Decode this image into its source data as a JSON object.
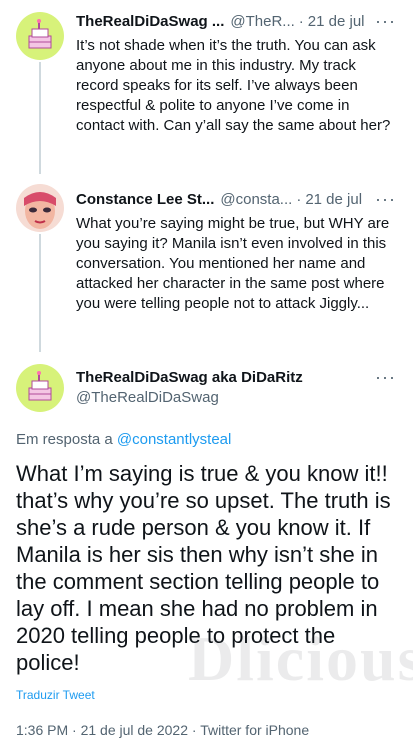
{
  "tweets": [
    {
      "name": "TheRealDiDaSwag ...",
      "handle": "@TheR...",
      "dot": "·",
      "date": "21 de jul",
      "text": "It’s not shade when it’s the truth. You can ask anyone about me in this industry. My track record speaks for its self. I’ve always been respectful & polite to anyone I’ve come in contact with. Can y’all say the same about her?"
    },
    {
      "name": "Constance Lee St...",
      "handle": "@consta...",
      "dot": "·",
      "date": "21 de jul",
      "text": "What you’re saying might be true, but WHY are you saying it? Manila isn’t even involved in this conversation. You mentioned her name and attacked her character in the same post where you were telling people not to attack Jiggly..."
    }
  ],
  "main_tweet": {
    "name": "TheRealDiDaSwag aka DiDaRitz",
    "handle": "@TheRealDiDaSwag",
    "reply_prefix": "Em resposta a ",
    "reply_handle": "@constantlysteal",
    "text": "What I’m saying is true & you know it!! that’s why you’re so upset. The truth is she’s a rude person & you know it. If Manila is her sis then why isn’t she in the comment section telling people to lay off. I mean she had no problem in 2020 telling people to protect the police!",
    "translate_label": "Traduzir Tweet",
    "meta": "1:36 PM · 21 de jul de 2022 · Twitter for iPhone"
  },
  "more_glyph": "···",
  "watermark": "Dlicious",
  "icons": {
    "more": "more-icon",
    "avatar_1": "cake-avatar",
    "avatar_2": "drag-avatar"
  },
  "colors": {
    "link": "#1d9bf0",
    "secondary": "#536471",
    "text": "#0f1419",
    "line": "#cfd9de"
  }
}
